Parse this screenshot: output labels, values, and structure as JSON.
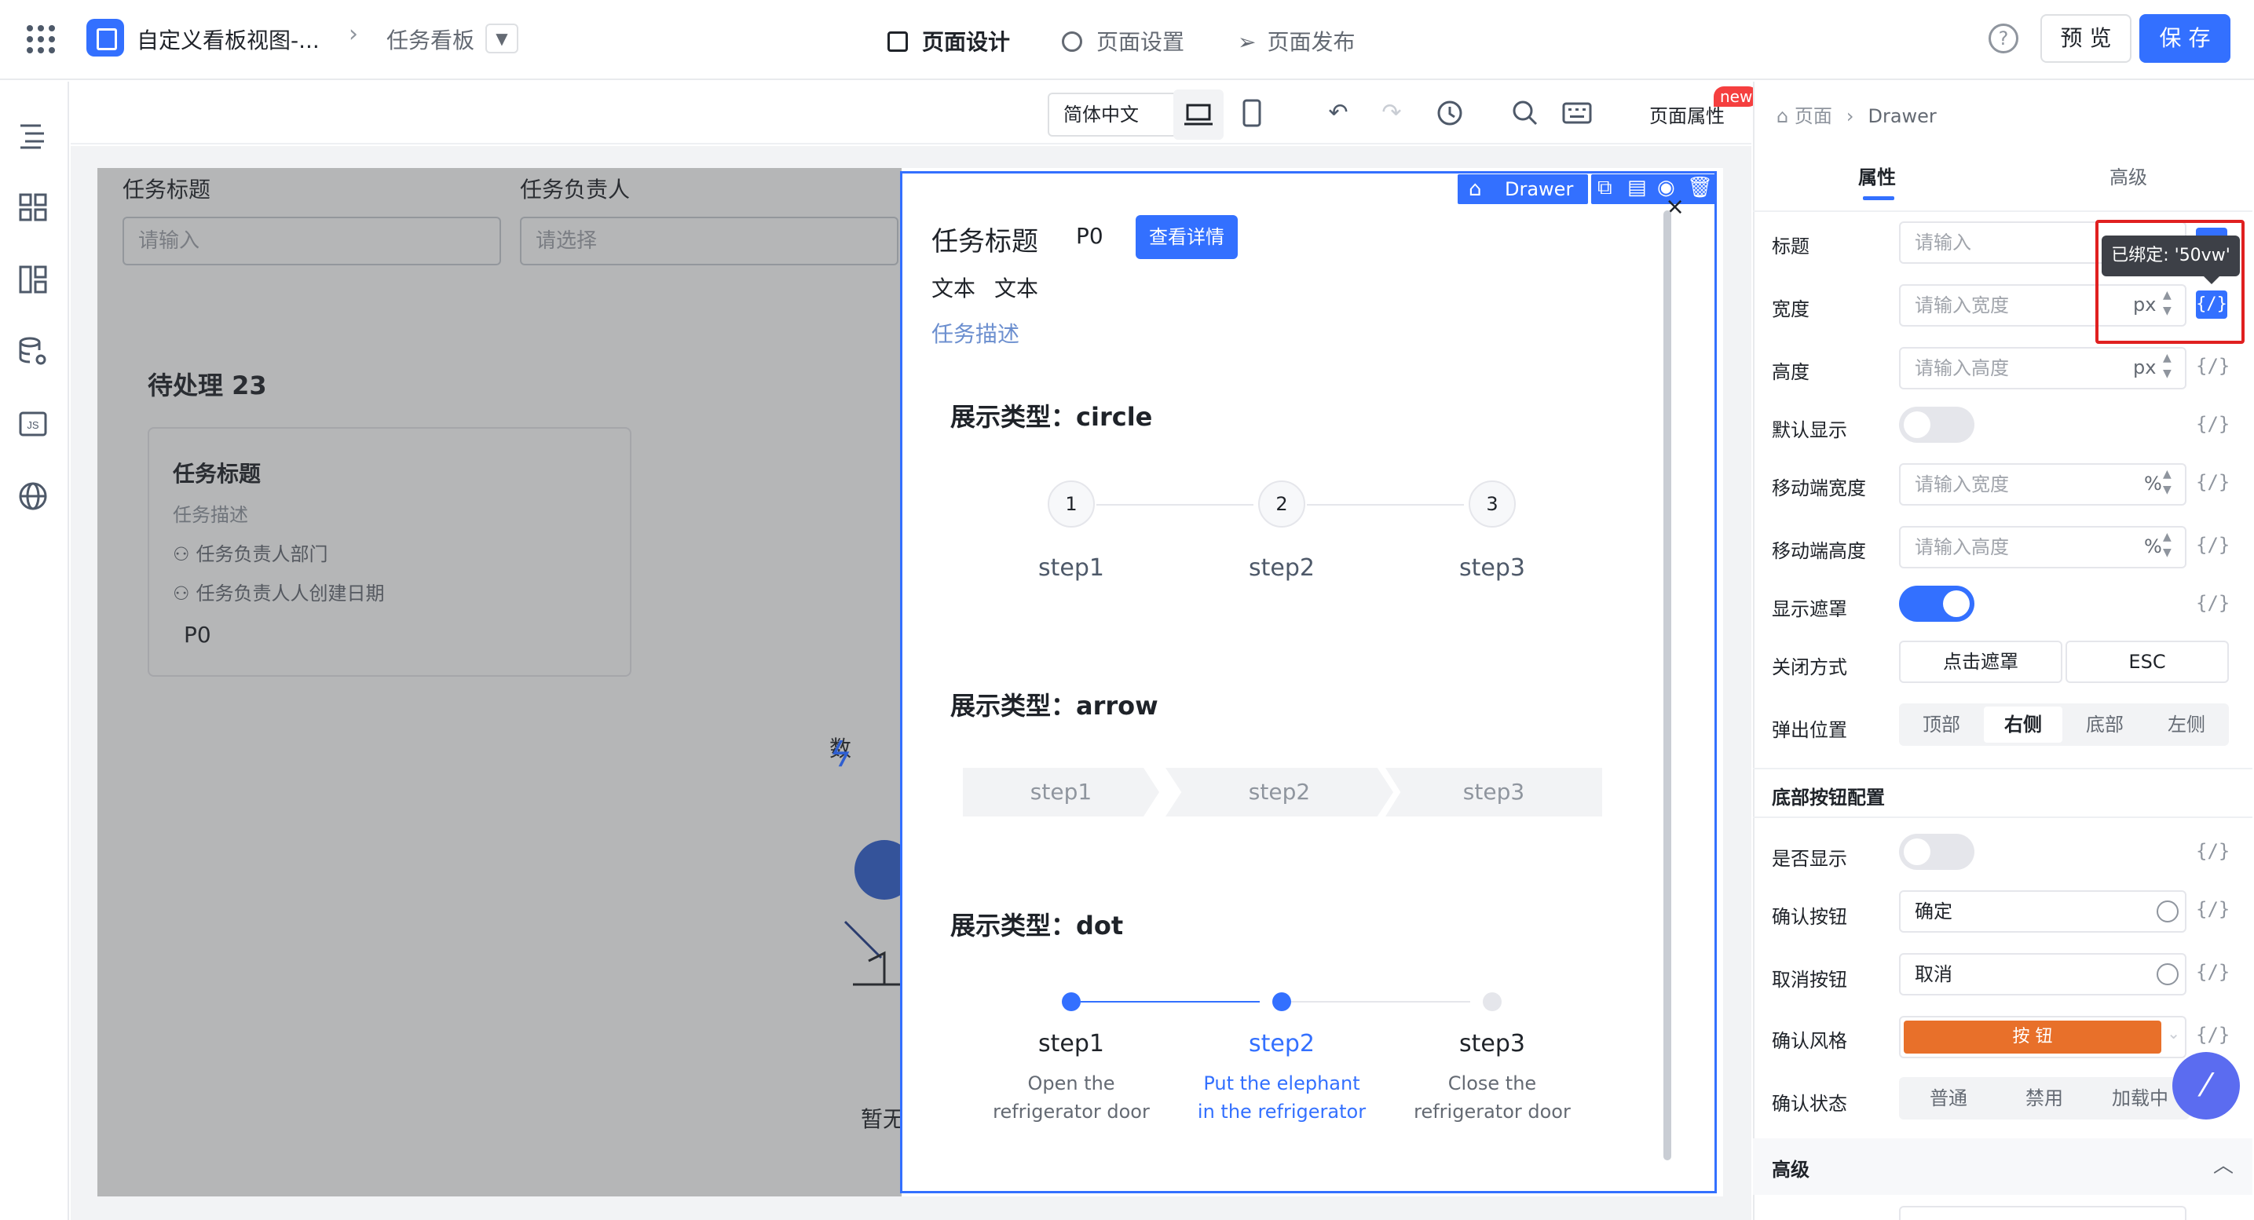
{
  "header": {
    "app_title": "自定义看板视图-...",
    "crumb": "任务看板",
    "tabs": [
      "页面设计",
      "页面设置",
      "页面发布"
    ],
    "help": "?",
    "preview": "预 览",
    "save": "保 存"
  },
  "toolbar": {
    "language": "简体中文",
    "page_props": "页面属性",
    "new_badge": "new"
  },
  "canvas": {
    "filter_labels": [
      "任务标题",
      "任务负责人"
    ],
    "filter_placeholders": [
      "请输入",
      "请选择"
    ],
    "column_title": "待处理 23",
    "card": {
      "title": "任务标题",
      "desc": "任务描述",
      "dept": "任务负责人部门",
      "created": "任务负责人人创建日期",
      "priority": "P0"
    },
    "empty_partial": "数",
    "empty_partial2": "暂无"
  },
  "drawer": {
    "tag": "Drawer",
    "close": "×",
    "title": "任务标题",
    "priority": "P0",
    "detail_button": "查看详情",
    "text1": "文本",
    "text2": "文本",
    "desc_link": "任务描述",
    "section_circle": "展示类型：circle",
    "section_arrow": "展示类型：arrow",
    "section_dot": "展示类型：dot",
    "circle_steps": [
      {
        "num": "1",
        "label": "step1"
      },
      {
        "num": "2",
        "label": "step2"
      },
      {
        "num": "3",
        "label": "step3"
      }
    ],
    "arrow_steps": [
      "step1",
      "step2",
      "step3"
    ],
    "dot_steps": [
      {
        "label": "step1",
        "desc1": "Open the",
        "desc2": "refrigerator door"
      },
      {
        "label": "step2",
        "desc1": "Put the elephant",
        "desc2": "in the refrigerator"
      },
      {
        "label": "step3",
        "desc1": "Close the",
        "desc2": "refrigerator door"
      }
    ]
  },
  "panel": {
    "crumb_root": "页面",
    "crumb_current": "Drawer",
    "tab_props": "属性",
    "tab_advanced": "高级",
    "tooltip": "已绑定: '50vw'",
    "bind_glyph": "{/}",
    "fields": {
      "title_label": "标题",
      "title_placeholder": "请输入",
      "width_label": "宽度",
      "width_placeholder": "请输入宽度",
      "height_label": "高度",
      "height_placeholder": "请输入高度",
      "unit_px": "px",
      "unit_pct": "%",
      "default_show": "默认显示",
      "mobile_width": "移动端宽度",
      "mobile_width_placeholder": "请输入宽度",
      "mobile_height": "移动端高度",
      "mobile_height_placeholder": "请输入高度",
      "show_mask": "显示遮罩",
      "close_mode": "关闭方式",
      "close_opts": [
        "点击遮罩",
        "ESC"
      ],
      "position": "弹出位置",
      "position_opts": [
        "顶部",
        "右侧",
        "底部",
        "左侧"
      ]
    },
    "footer_section": "底部按钮配置",
    "footer": {
      "visible": "是否显示",
      "confirm_label": "确认按钮",
      "confirm_value": "确定",
      "cancel_label": "取消按钮",
      "cancel_value": "取消",
      "style_label": "确认风格",
      "style_value": "按 钮",
      "state_label": "确认状态",
      "state_opts": [
        "普通",
        "禁用",
        "加载中"
      ]
    },
    "advanced_section": "高级"
  },
  "colors": {
    "primary": "#3370ff",
    "orange": "#e8702a",
    "highlight_box": "#e02020"
  }
}
